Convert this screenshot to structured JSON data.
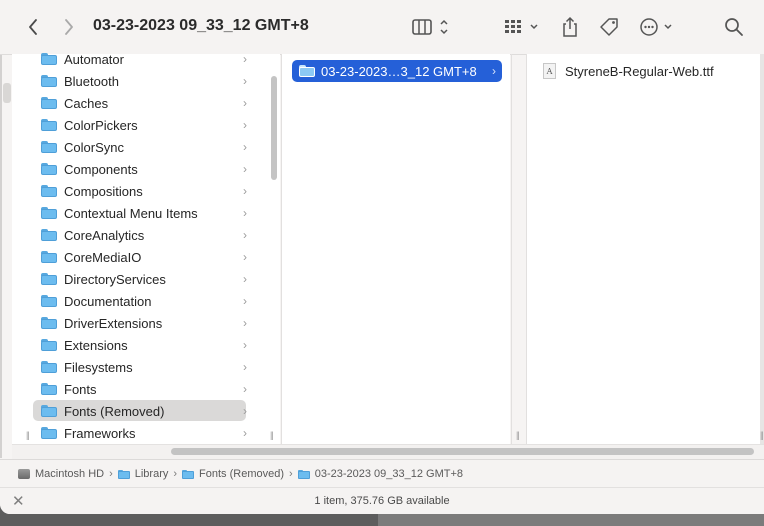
{
  "window": {
    "title": "03-23-2023 09_33_12 GMT+8"
  },
  "toolbar": {
    "back_icon": "chevron-left-icon",
    "forward_icon": "chevron-right-icon",
    "view_icon": "column-view-icon",
    "group_icon": "grid-group-icon",
    "share_icon": "share-icon",
    "tag_icon": "tag-icon",
    "more_icon": "ellipsis-circle-icon",
    "search_icon": "search-icon"
  },
  "column1": {
    "items": [
      {
        "label": "Automator"
      },
      {
        "label": "Bluetooth"
      },
      {
        "label": "Caches"
      },
      {
        "label": "ColorPickers"
      },
      {
        "label": "ColorSync"
      },
      {
        "label": "Components"
      },
      {
        "label": "Compositions"
      },
      {
        "label": "Contextual Menu Items"
      },
      {
        "label": "CoreAnalytics"
      },
      {
        "label": "CoreMediaIO"
      },
      {
        "label": "DirectoryServices"
      },
      {
        "label": "Documentation"
      },
      {
        "label": "DriverExtensions"
      },
      {
        "label": "Extensions"
      },
      {
        "label": "Filesystems"
      },
      {
        "label": "Fonts"
      },
      {
        "label": "Fonts (Removed)"
      },
      {
        "label": "Frameworks"
      }
    ],
    "selected_label": "Fonts (Removed)"
  },
  "column2": {
    "selected_label": "03-23-2023…3_12 GMT+8"
  },
  "column3": {
    "file_label": "StyreneB-Regular-Web.ttf"
  },
  "pathbar": {
    "crumbs": [
      {
        "label": "Macintosh HD"
      },
      {
        "label": "Library"
      },
      {
        "label": "Fonts (Removed)"
      },
      {
        "label": "03-23-2023 09_33_12 GMT+8"
      }
    ]
  },
  "status": {
    "text": "1 item, 375.76 GB available"
  },
  "colors": {
    "selection": "#2560d8",
    "folder": "#6cbcef"
  }
}
